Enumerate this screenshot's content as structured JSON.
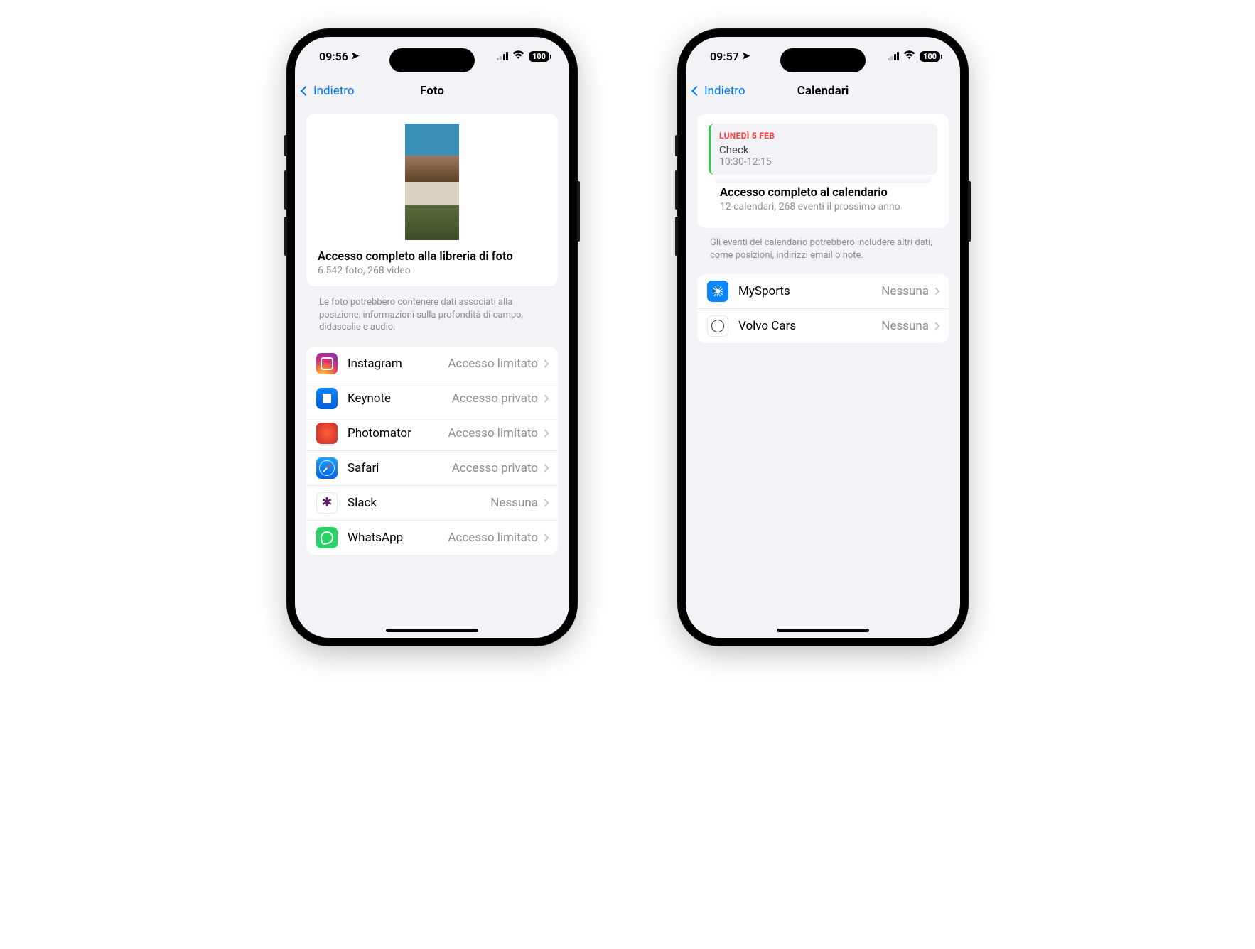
{
  "left": {
    "status": {
      "time": "09:56",
      "battery": "100"
    },
    "nav": {
      "back": "Indietro",
      "title": "Foto"
    },
    "header": {
      "title": "Accesso completo alla libreria di foto",
      "subtitle": "6.542 foto, 268 video"
    },
    "note": "Le foto potrebbero contenere dati associati alla posizione, informazioni sulla profondità di campo, didascalie e audio.",
    "apps": [
      {
        "name": "Instagram",
        "value": "Accesso limitato",
        "icon": "ic-instagram"
      },
      {
        "name": "Keynote",
        "value": "Accesso privato",
        "icon": "ic-keynote"
      },
      {
        "name": "Photomator",
        "value": "Accesso limitato",
        "icon": "ic-photomator"
      },
      {
        "name": "Safari",
        "value": "Accesso privato",
        "icon": "ic-safari"
      },
      {
        "name": "Slack",
        "value": "Nessuna",
        "icon": "ic-slack"
      },
      {
        "name": "WhatsApp",
        "value": "Accesso limitato",
        "icon": "ic-whatsapp"
      }
    ]
  },
  "right": {
    "status": {
      "time": "09:57",
      "battery": "100"
    },
    "nav": {
      "back": "Indietro",
      "title": "Calendari"
    },
    "event": {
      "date": "LUNEDÌ 5 FEB",
      "title": "Check",
      "time": "10:30-12:15"
    },
    "header": {
      "title": "Accesso completo al calendario",
      "subtitle": "12 calendari, 268 eventi il prossimo anno"
    },
    "note": "Gli eventi del calendario potrebbero includere altri dati, come posizioni, indirizzi email o note.",
    "apps": [
      {
        "name": "MySports",
        "value": "Nessuna",
        "icon": "ic-mysports"
      },
      {
        "name": "Volvo Cars",
        "value": "Nessuna",
        "icon": "ic-volvo"
      }
    ]
  }
}
